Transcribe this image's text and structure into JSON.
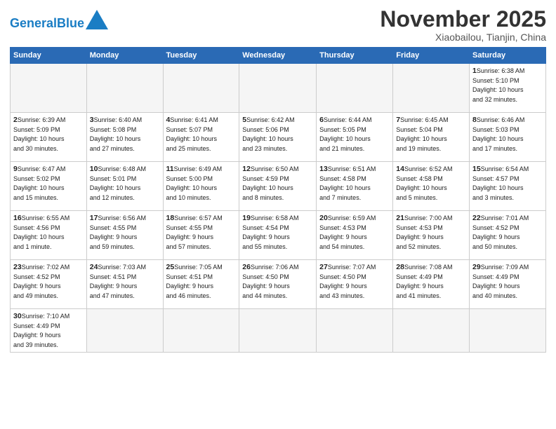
{
  "header": {
    "logo_general": "General",
    "logo_blue": "Blue",
    "title": "November 2025",
    "subtitle": "Xiaobailou, Tianjin, China"
  },
  "days_of_week": [
    "Sunday",
    "Monday",
    "Tuesday",
    "Wednesday",
    "Thursday",
    "Friday",
    "Saturday"
  ],
  "weeks": [
    [
      {
        "day": "",
        "info": ""
      },
      {
        "day": "",
        "info": ""
      },
      {
        "day": "",
        "info": ""
      },
      {
        "day": "",
        "info": ""
      },
      {
        "day": "",
        "info": ""
      },
      {
        "day": "",
        "info": ""
      },
      {
        "day": "1",
        "info": "Sunrise: 6:38 AM\nSunset: 5:10 PM\nDaylight: 10 hours\nand 32 minutes."
      }
    ],
    [
      {
        "day": "2",
        "info": "Sunrise: 6:39 AM\nSunset: 5:09 PM\nDaylight: 10 hours\nand 30 minutes."
      },
      {
        "day": "3",
        "info": "Sunrise: 6:40 AM\nSunset: 5:08 PM\nDaylight: 10 hours\nand 27 minutes."
      },
      {
        "day": "4",
        "info": "Sunrise: 6:41 AM\nSunset: 5:07 PM\nDaylight: 10 hours\nand 25 minutes."
      },
      {
        "day": "5",
        "info": "Sunrise: 6:42 AM\nSunset: 5:06 PM\nDaylight: 10 hours\nand 23 minutes."
      },
      {
        "day": "6",
        "info": "Sunrise: 6:44 AM\nSunset: 5:05 PM\nDaylight: 10 hours\nand 21 minutes."
      },
      {
        "day": "7",
        "info": "Sunrise: 6:45 AM\nSunset: 5:04 PM\nDaylight: 10 hours\nand 19 minutes."
      },
      {
        "day": "8",
        "info": "Sunrise: 6:46 AM\nSunset: 5:03 PM\nDaylight: 10 hours\nand 17 minutes."
      }
    ],
    [
      {
        "day": "9",
        "info": "Sunrise: 6:47 AM\nSunset: 5:02 PM\nDaylight: 10 hours\nand 15 minutes."
      },
      {
        "day": "10",
        "info": "Sunrise: 6:48 AM\nSunset: 5:01 PM\nDaylight: 10 hours\nand 12 minutes."
      },
      {
        "day": "11",
        "info": "Sunrise: 6:49 AM\nSunset: 5:00 PM\nDaylight: 10 hours\nand 10 minutes."
      },
      {
        "day": "12",
        "info": "Sunrise: 6:50 AM\nSunset: 4:59 PM\nDaylight: 10 hours\nand 8 minutes."
      },
      {
        "day": "13",
        "info": "Sunrise: 6:51 AM\nSunset: 4:58 PM\nDaylight: 10 hours\nand 7 minutes."
      },
      {
        "day": "14",
        "info": "Sunrise: 6:52 AM\nSunset: 4:58 PM\nDaylight: 10 hours\nand 5 minutes."
      },
      {
        "day": "15",
        "info": "Sunrise: 6:54 AM\nSunset: 4:57 PM\nDaylight: 10 hours\nand 3 minutes."
      }
    ],
    [
      {
        "day": "16",
        "info": "Sunrise: 6:55 AM\nSunset: 4:56 PM\nDaylight: 10 hours\nand 1 minute."
      },
      {
        "day": "17",
        "info": "Sunrise: 6:56 AM\nSunset: 4:55 PM\nDaylight: 9 hours\nand 59 minutes."
      },
      {
        "day": "18",
        "info": "Sunrise: 6:57 AM\nSunset: 4:55 PM\nDaylight: 9 hours\nand 57 minutes."
      },
      {
        "day": "19",
        "info": "Sunrise: 6:58 AM\nSunset: 4:54 PM\nDaylight: 9 hours\nand 55 minutes."
      },
      {
        "day": "20",
        "info": "Sunrise: 6:59 AM\nSunset: 4:53 PM\nDaylight: 9 hours\nand 54 minutes."
      },
      {
        "day": "21",
        "info": "Sunrise: 7:00 AM\nSunset: 4:53 PM\nDaylight: 9 hours\nand 52 minutes."
      },
      {
        "day": "22",
        "info": "Sunrise: 7:01 AM\nSunset: 4:52 PM\nDaylight: 9 hours\nand 50 minutes."
      }
    ],
    [
      {
        "day": "23",
        "info": "Sunrise: 7:02 AM\nSunset: 4:52 PM\nDaylight: 9 hours\nand 49 minutes."
      },
      {
        "day": "24",
        "info": "Sunrise: 7:03 AM\nSunset: 4:51 PM\nDaylight: 9 hours\nand 47 minutes."
      },
      {
        "day": "25",
        "info": "Sunrise: 7:05 AM\nSunset: 4:51 PM\nDaylight: 9 hours\nand 46 minutes."
      },
      {
        "day": "26",
        "info": "Sunrise: 7:06 AM\nSunset: 4:50 PM\nDaylight: 9 hours\nand 44 minutes."
      },
      {
        "day": "27",
        "info": "Sunrise: 7:07 AM\nSunset: 4:50 PM\nDaylight: 9 hours\nand 43 minutes."
      },
      {
        "day": "28",
        "info": "Sunrise: 7:08 AM\nSunset: 4:49 PM\nDaylight: 9 hours\nand 41 minutes."
      },
      {
        "day": "29",
        "info": "Sunrise: 7:09 AM\nSunset: 4:49 PM\nDaylight: 9 hours\nand 40 minutes."
      }
    ],
    [
      {
        "day": "30",
        "info": "Sunrise: 7:10 AM\nSunset: 4:49 PM\nDaylight: 9 hours\nand 39 minutes."
      },
      {
        "day": "",
        "info": ""
      },
      {
        "day": "",
        "info": ""
      },
      {
        "day": "",
        "info": ""
      },
      {
        "day": "",
        "info": ""
      },
      {
        "day": "",
        "info": ""
      },
      {
        "day": "",
        "info": ""
      }
    ]
  ]
}
